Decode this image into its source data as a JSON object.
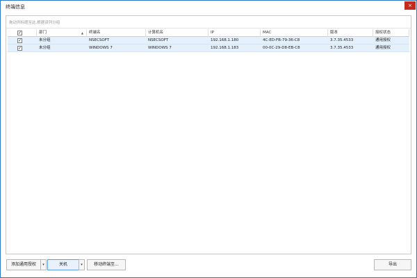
{
  "window": {
    "title": "终端信息",
    "close_label": "×"
  },
  "grouping": {
    "hint": "拖动列标题至此,根据该列分组"
  },
  "table": {
    "headers": [
      "部门",
      "终端名",
      "计算机名",
      "IP",
      "MAC",
      "版本",
      "授权状态"
    ],
    "sort_icon": "▲",
    "rows": [
      {
        "checked": "✓",
        "dept": "未分组",
        "terminal": "NSECSOFT",
        "computer": "NSECSOFT",
        "ip": "192.168.1.180",
        "mac": "4C-ED-FB-79-36-C8",
        "version": "3.7.35.4533",
        "auth": "通用授权"
      },
      {
        "checked": "✓",
        "dept": "未分组",
        "terminal": "WINDOWS 7",
        "computer": "WINDOWS 7",
        "ip": "192.168.1.183",
        "mac": "00-0C-29-D8-EB-C8",
        "version": "3.7.35.4533",
        "auth": "通用授权"
      }
    ],
    "header_checked": "✓"
  },
  "footer": {
    "add_license_label": "添加通用授权",
    "shutdown_label": "关机",
    "move_terminal_label": "移动终端至...",
    "export_label": "导出",
    "dropdown_arrow": "▾"
  }
}
